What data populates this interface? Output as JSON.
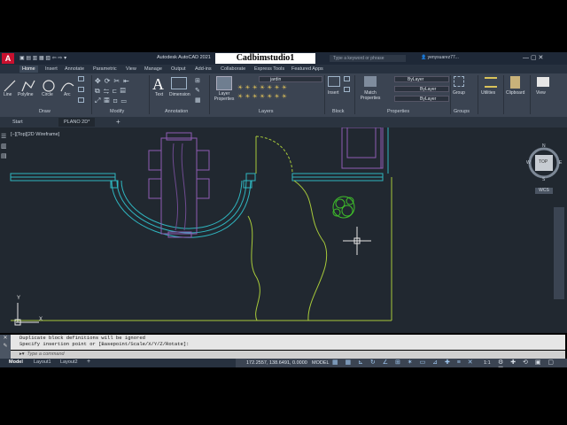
{
  "titlebar": {
    "app_title": "Autodesk AutoCAD 2021",
    "overlay_text": "Cadbimstudio1",
    "search_placeholder": "Type a keyword or phrase",
    "user": "yenysuarez77..."
  },
  "menu_tabs": [
    "Home",
    "Insert",
    "Annotate",
    "Parametric",
    "View",
    "Manage",
    "Output",
    "Add-ins",
    "Collaborate",
    "Express Tools",
    "Featured Apps"
  ],
  "ribbon": {
    "draw_tools": [
      "Line",
      "Polyline",
      "Circle",
      "Arc"
    ],
    "annotation_tools": [
      "Text",
      "Dimension"
    ],
    "layer_properties": "Layer Properties",
    "layer_combo": "jardin",
    "insert": "Insert",
    "match_properties": "Match Properties",
    "bylayer": "ByLayer",
    "group": "Group",
    "utilities": "Utilities",
    "clipboard": "Clipboard",
    "view": "View",
    "panel_labels": [
      "Draw",
      "Modify",
      "Annotation",
      "Layers",
      "Block",
      "Properties",
      "Groups"
    ]
  },
  "doc_tabs": [
    "Start",
    "PLANO 2D*"
  ],
  "viewport_label": "[−][Top][2D Wireframe]",
  "viewcube": {
    "face": "TOP",
    "n": "N",
    "s": "S",
    "e": "E",
    "w": "W",
    "wcs": "WCS"
  },
  "ucs": {
    "y": "Y",
    "x": "X"
  },
  "command": {
    "history": [
      "Duplicate block definitions will be ignored",
      "Specify insertion point or [Basepoint/Scale/X/Y/Z/Rotate]:"
    ],
    "input_placeholder": "Type a command"
  },
  "status": {
    "layout_tabs": [
      "Model",
      "Layout1",
      "Layout2"
    ],
    "coords": "172.2557, 138.6491, 0.0000",
    "model": "MODEL",
    "scale": "1:1"
  },
  "colors": {
    "canvas": "#212830",
    "walls": "#2fb6c0",
    "furniture": "#8e5bb3",
    "ground": "#a7c93a",
    "plant": "#3fbf2a",
    "ribbon": "#3b4452"
  }
}
